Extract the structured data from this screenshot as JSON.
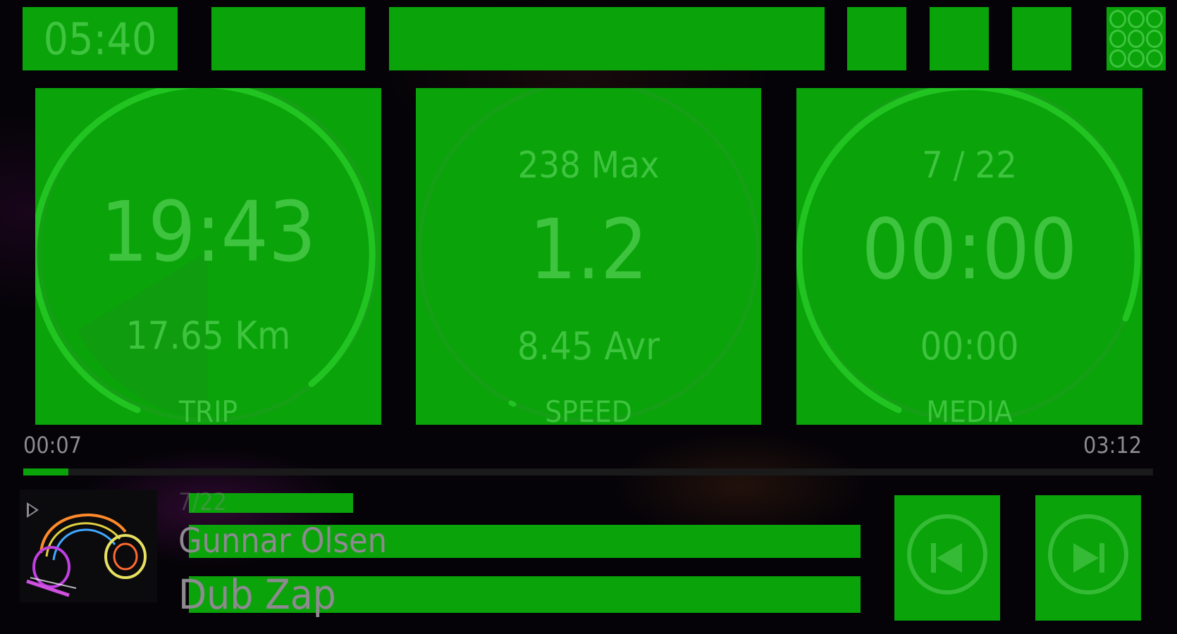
{
  "colors": {
    "tile": "#0aa30a",
    "tile_text": "#3ec43e",
    "ring": "#22c422",
    "muted_text": "#8d8a90",
    "background": "#050308"
  },
  "status_bar": {
    "clock": "05:40",
    "apps_icon": "grid-dots-icon"
  },
  "gauges": {
    "trip": {
      "label": "TRIP",
      "main": "19:43",
      "sub": "17.65 Km"
    },
    "speed": {
      "label": "SPEED",
      "top": "238 Max",
      "main": "1.2",
      "sub": "8.45 Avr"
    },
    "media": {
      "label": "MEDIA",
      "top": "7 / 22",
      "main": "00:00",
      "sub": "00:00"
    }
  },
  "player": {
    "elapsed": "00:07",
    "duration": "03:12",
    "progress_fraction": 0.04,
    "track_number": "7/22",
    "artist": "Gunnar Olsen",
    "title": "Dub Zap",
    "play_icon": "play-icon",
    "prev_icon": "skip-previous-icon",
    "next_icon": "skip-next-icon"
  }
}
